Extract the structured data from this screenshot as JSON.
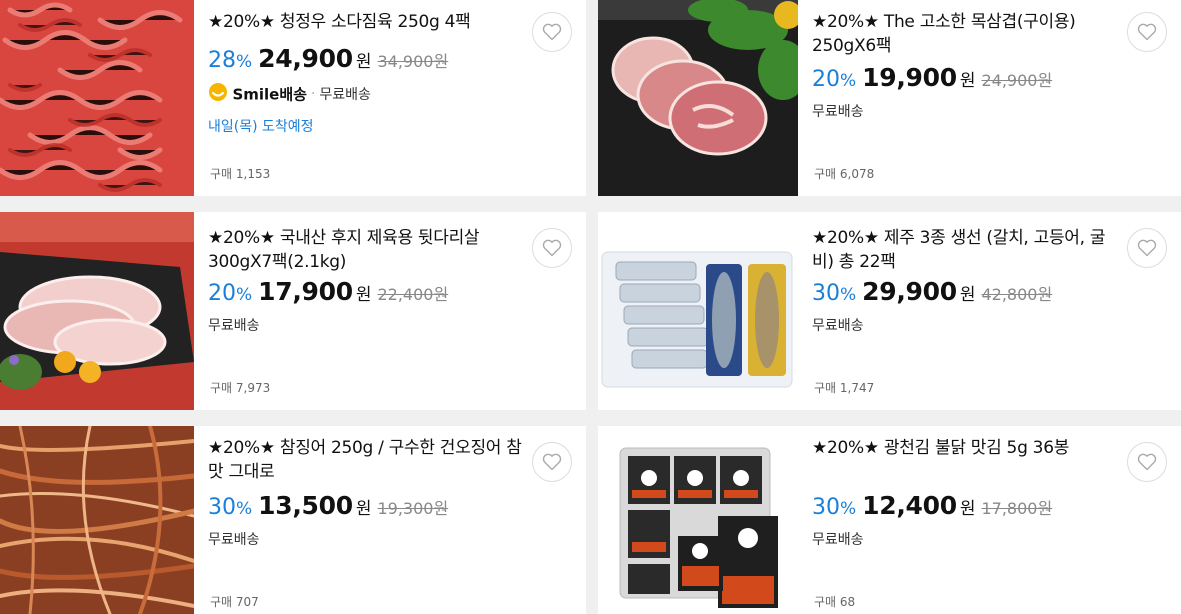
{
  "products": [
    {
      "title": "★20%★ 청정우 소다짐육 250g 4팩",
      "discount": "28",
      "price": "24,900",
      "original_price": "34,900원",
      "shipping": "무료배송",
      "smile_label": "Smile배송",
      "arrival": "내일(목) 도착예정",
      "sold": "구매 1,153",
      "image_icon": "ground-beef-image"
    },
    {
      "title": "★20%★ The 고소한 목삼겹(구이용) 250gX6팩",
      "discount": "20",
      "price": "19,900",
      "original_price": "24,900원",
      "shipping": "무료배송",
      "sold": "구매 6,078",
      "image_icon": "pork-neck-image"
    },
    {
      "title": "★20%★ 국내산 후지 제육용 뒷다리살 300gX7팩(2.1kg)",
      "discount": "20",
      "price": "17,900",
      "original_price": "22,400원",
      "shipping": "무료배송",
      "sold": "구매 7,973",
      "image_icon": "pork-leg-image"
    },
    {
      "title": "★20%★ 제주 3종 생선 (갈치, 고등어, 굴비) 총 22팩",
      "discount": "30",
      "price": "29,900",
      "original_price": "42,800원",
      "shipping": "무료배송",
      "sold": "구매 1,747",
      "image_icon": "fish-set-image"
    },
    {
      "title": "★20%★ 참징어 250g / 구수한 건오징어 참 맛 그대로",
      "discount": "30",
      "price": "13,500",
      "original_price": "19,300원",
      "shipping": "무료배송",
      "sold": "구매 707",
      "image_icon": "dried-squid-image"
    },
    {
      "title": "★20%★ 광천김 불닭 맛김 5g 36봉",
      "discount": "30",
      "price": "12,400",
      "original_price": "17,800원",
      "shipping": "무료배송",
      "sold": "구매 68",
      "image_icon": "seaweed-pack-image"
    }
  ],
  "won_unit": "원",
  "pct_unit": "%",
  "colors": {
    "discount": "#1a7fd9",
    "background": "#f0f0f0"
  }
}
